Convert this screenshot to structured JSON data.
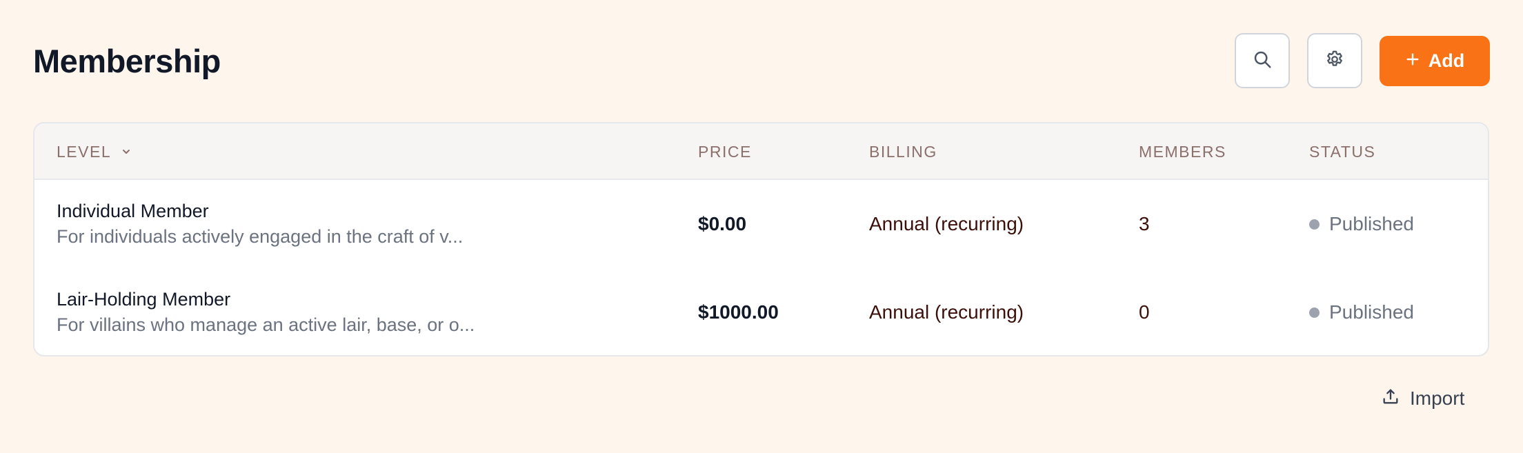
{
  "page": {
    "title": "Membership"
  },
  "toolbar": {
    "search_icon": "search-icon",
    "settings_icon": "gear-icon",
    "add_label": "Add"
  },
  "table": {
    "columns": {
      "level": "LEVEL",
      "price": "PRICE",
      "billing": "BILLING",
      "members": "MEMBERS",
      "status": "STATUS"
    },
    "rows": [
      {
        "name": "Individual Member",
        "description": "For individuals actively engaged in the craft of v...",
        "price": "$0.00",
        "billing": "Annual (recurring)",
        "members": "3",
        "status": "Published"
      },
      {
        "name": "Lair-Holding Member",
        "description": "For villains who manage an active lair, base, or o...",
        "price": "$1000.00",
        "billing": "Annual (recurring)",
        "members": "0",
        "status": "Published"
      }
    ]
  },
  "footer": {
    "import_label": "Import"
  },
  "colors": {
    "background": "#fef5ec",
    "accent": "#f97316",
    "status_dot": "#9ca3af"
  }
}
